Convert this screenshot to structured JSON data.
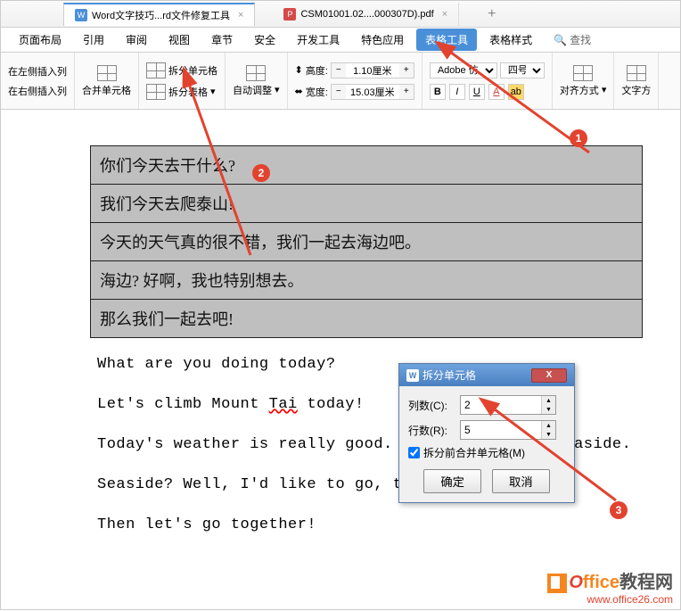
{
  "tabs": {
    "word_tab": "Word文字技巧...rd文件修复工具",
    "pdf_tab": "CSM01001.02....000307D).pdf"
  },
  "menu": {
    "page_layout": "页面布局",
    "references": "引用",
    "review": "审阅",
    "view": "视图",
    "chapter": "章节",
    "security": "安全",
    "dev_tools": "开发工具",
    "special": "特色应用",
    "table_tools": "表格工具",
    "table_style": "表格样式",
    "find": "查找"
  },
  "toolbar": {
    "insert_left": "在左侧插入列",
    "insert_right": "在右侧插入列",
    "merge_cells": "合并单元格",
    "split_cells": "拆分单元格",
    "split_table": "拆分表格",
    "auto_fit": "自动调整",
    "height_label": "高度:",
    "height_value": "1.10厘米",
    "width_label": "宽度:",
    "width_value": "15.03厘米",
    "font_name": "Adobe 仿",
    "font_size": "四号",
    "align": "对齐方式",
    "text_dir": "文字方"
  },
  "table": {
    "r1": "你们今天去干什么?",
    "r2": "我们今天去爬泰山!",
    "r3": "今天的天气真的很不错，我们一起去海边吧。",
    "r4": "海边? 好啊，我也特别想去。",
    "r5": "那么我们一起去吧!"
  },
  "paras": {
    "p1": "What are you doing today?",
    "p2a": "Let's climb Mount ",
    "p2b": "Tai",
    "p2c": " today!",
    "p3": "Today's weather is really good. Let's go to the seaside.",
    "p4": "Seaside? Well, I'd like to go, too.",
    "p5": "Then let's go together!"
  },
  "dialog": {
    "title": "拆分单元格",
    "cols_label": "列数(C):",
    "cols_value": "2",
    "rows_label": "行数(R):",
    "rows_value": "5",
    "merge_before": "拆分前合并单元格(M)",
    "ok": "确定",
    "cancel": "取消"
  },
  "callouts": {
    "c1": "1",
    "c2": "2",
    "c3": "3"
  },
  "watermark": {
    "line1a": "O",
    "line1b": "ffice",
    "line1c": "教程网",
    "line2": "www.office26.com"
  }
}
